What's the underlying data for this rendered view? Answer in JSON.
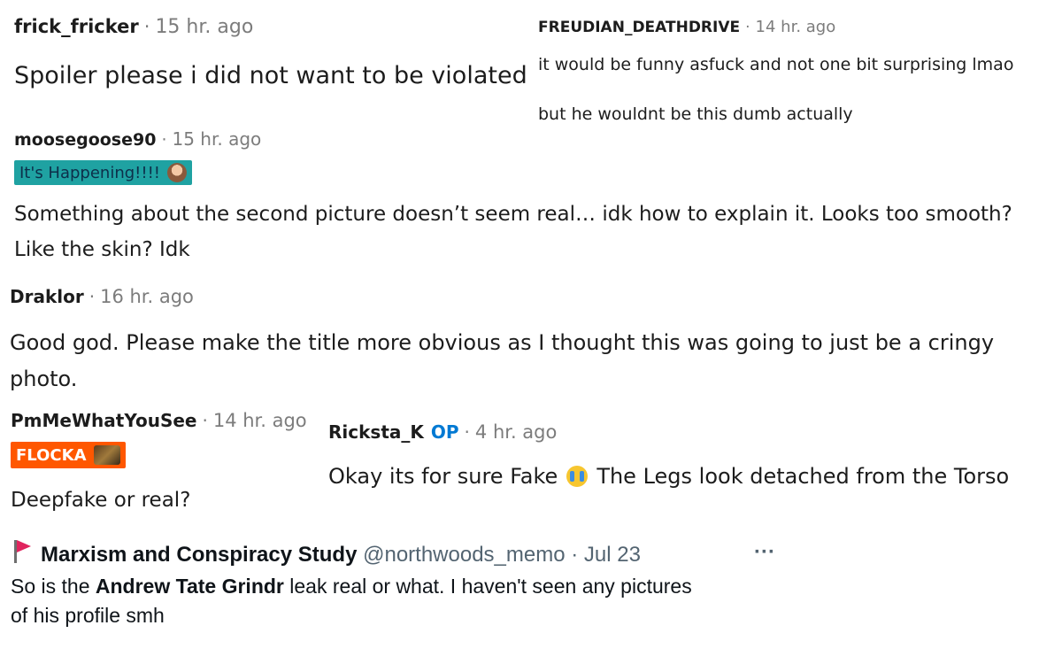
{
  "comments": [
    {
      "username": "frick_fricker",
      "time": "15 hr. ago",
      "text": "Spoiler please i did not want to be violated"
    },
    {
      "username": "FREUDIAN_DEATHDRIVE",
      "time": "14 hr. ago",
      "lines": [
        "it would be funny asfuck and not one bit surprising lmao",
        "but he wouldnt be this dumb actually"
      ]
    },
    {
      "username": "moosegoose90",
      "time": "15 hr. ago",
      "flair": "It's Happening!!!!",
      "lines": [
        "Something about the second picture doesn’t seem real… idk how to explain it. Looks too smooth?",
        "Like the skin? Idk"
      ]
    },
    {
      "username": "Draklor",
      "time": "16 hr. ago",
      "lines": [
        "Good god. Please make the title more obvious as I thought this was going to just be a cringy",
        "photo."
      ]
    },
    {
      "username": "PmMeWhatYouSee",
      "time": "14 hr. ago",
      "flair": "FLOCKA",
      "text": "Deepfake or real?"
    },
    {
      "username": "Ricksta_K",
      "op": "OP",
      "time": "4 hr. ago",
      "text_before": "Okay its for sure Fake",
      "text_after": "The Legs look detached from the Torso"
    }
  ],
  "tweet": {
    "name": "Marxism and Conspiracy Study",
    "handle": "@northwoods_memo",
    "date": "Jul 23",
    "more": "···",
    "line1_a": "So is the ",
    "line1_bold": "Andrew Tate Grindr",
    "line1_b": " leak real or what. I haven't seen any pictures",
    "line2": "of his profile smh"
  },
  "colors": {
    "flair_teal": "#1fa2a2",
    "flair_orange": "#ff5700",
    "op_blue": "#0079d3",
    "flag_red": "#e0245e"
  }
}
